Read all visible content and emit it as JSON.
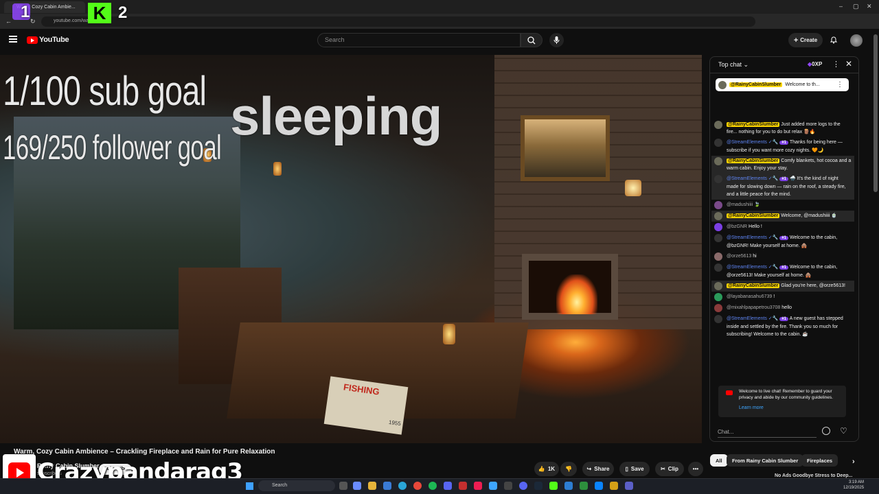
{
  "browser": {
    "tab_title": "Warm, Cozy Cabin Ambie...",
    "url": "youtube.com/watch?v=...",
    "window_controls": [
      "–",
      "▢",
      "✕"
    ]
  },
  "stream_overlay": {
    "twitch_count": "1",
    "kick_count": "2",
    "kick_logo": "K",
    "sub_goal": "1/100 sub goal",
    "follower_goal": "169/250 follower goal",
    "status": "sleeping",
    "streamer_name": "Crazypandarag3"
  },
  "header": {
    "brand": "YouTube",
    "search_placeholder": "Search",
    "create_label": "Create"
  },
  "video": {
    "magazine_title": "FISHING",
    "magazine_year": "1955",
    "title": "Warm, Cozy Cabin Ambience – Crackling Fireplace and Rain for Pure Relaxation",
    "channel": "Rainy Cabin Slumber",
    "subscribers": "subscribers",
    "subscribe_label": "Subscribe"
  },
  "actions": {
    "likes": "1K",
    "share": "Share",
    "save": "Save",
    "clip": "Clip",
    "more": "•••"
  },
  "chat": {
    "mode": "Top chat",
    "xp": "0XP",
    "pinned_author": "@RainyCabinSlumber",
    "pinned_text": "Welcome to th...",
    "messages": [
      {
        "author": "@RainyCabinSlumber",
        "role": "owner",
        "badge": "",
        "text": "Just added more logs to the fire... nothing for you to do but relax 🪵🔥",
        "hl": false
      },
      {
        "author": "@StreamElements ✓🔧",
        "role": "mod",
        "badge": "#1",
        "text": "Thanks for being here — subscribe if you want more cozy nights. 🧡🌙",
        "hl": false
      },
      {
        "author": "@RainyCabinSlumber",
        "role": "owner",
        "badge": "",
        "text": "Comfy blankets, hot cocoa and a warm cabin. Enjoy your stay.",
        "hl": true
      },
      {
        "author": "@StreamElements ✓🔧",
        "role": "mod",
        "badge": "#1",
        "text": "🌧️ It's the kind of night made for slowing down — rain on the roof, a steady fire, and a little peace for the mind.",
        "hl": true
      },
      {
        "author": "@madushiiii",
        "role": "user",
        "badge": "",
        "text": "🍃",
        "hl": false
      },
      {
        "author": "@RainyCabinSlumber",
        "role": "owner",
        "badge": "",
        "text": "Welcome, @madushiiii 🍵",
        "hl": true
      },
      {
        "author": "@bzGNR",
        "role": "user",
        "badge": "",
        "text": "Hello !",
        "hl": false
      },
      {
        "author": "@StreamElements ✓🔧",
        "role": "mod",
        "badge": "#1",
        "text": "Welcome to the cabin, @bzGNR! Make yourself at home. 🛖",
        "hl": false
      },
      {
        "author": "@orze5613",
        "role": "user",
        "badge": "",
        "text": "hi",
        "hl": false
      },
      {
        "author": "@StreamElements ✓🔧",
        "role": "mod",
        "badge": "#1",
        "text": "Welcome to the cabin, @orze5613! Make yourself at home. 🛖",
        "hl": false
      },
      {
        "author": "@RainyCabinSlumber",
        "role": "owner",
        "badge": "",
        "text": "Glad you're here, @orze5613!",
        "hl": true
      },
      {
        "author": "@layabanasahu6739",
        "role": "user",
        "badge": "",
        "text": "!",
        "hl": false
      },
      {
        "author": "@mixahlpapapetrou3708",
        "role": "user",
        "badge": "",
        "text": "hello",
        "hl": false
      },
      {
        "author": "@StreamElements ✓🔧",
        "role": "mod",
        "badge": "#1",
        "text": "A new guest has stepped inside and settled by the fire. Thank you so much for subscribing! Welcome to the cabin. ☕",
        "hl": false
      }
    ],
    "notice": "Welcome to live chat! Remember to guard your privacy and abide by our community guidelines.",
    "learn_more": "Learn more",
    "input_placeholder": "Chat..."
  },
  "chips": [
    "All",
    "From Rainy Cabin Slumber",
    "Fireplaces"
  ],
  "recommendation_title": "No Ads Goodbye Stress to Deep...",
  "taskbar": {
    "search": "Search",
    "time": "3:19 AM",
    "date": "12/19/2025"
  },
  "colors": {
    "yt_red": "#ff0000",
    "kick_green": "#53fc18",
    "twitch_purple": "#9146ff",
    "owner_badge": "#ffd600",
    "mod_name": "#5e84f1",
    "link": "#3ea6ff"
  }
}
